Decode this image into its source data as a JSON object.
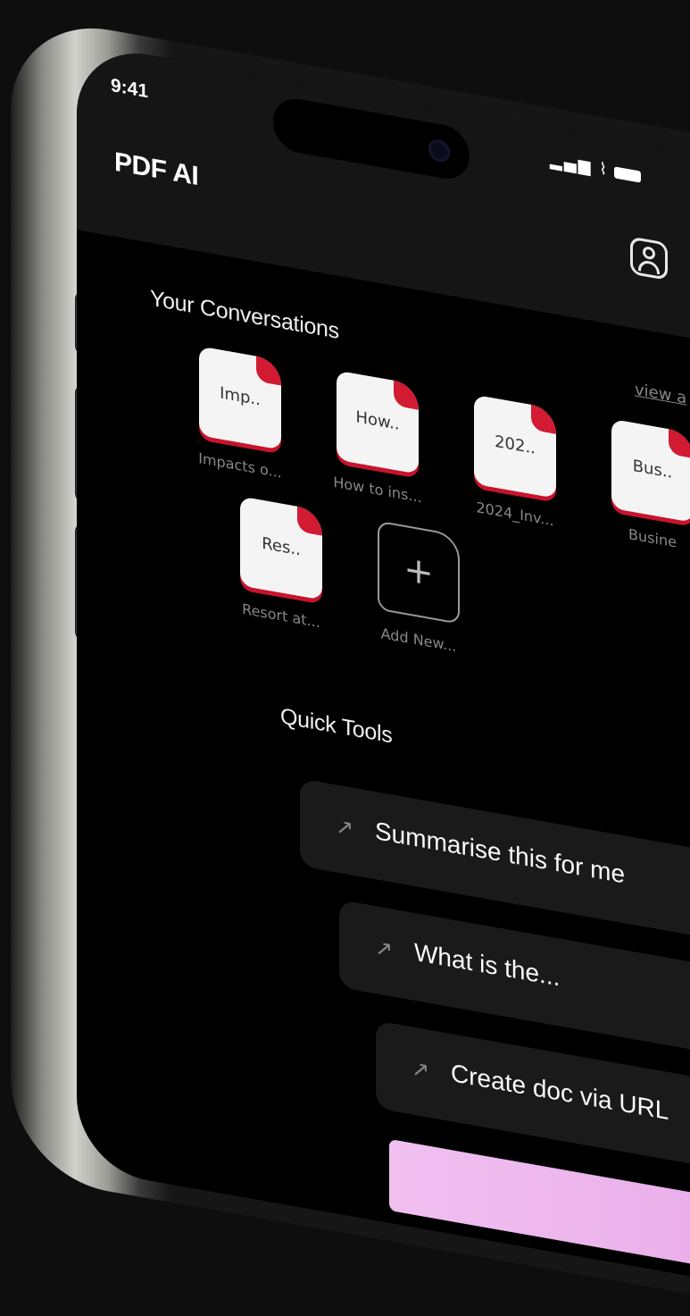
{
  "status_bar": {
    "time": "9:41",
    "signal_wifi": "▂▄▆ ⌇"
  },
  "header": {
    "title": "PDF AI",
    "profile_icon": "user-icon"
  },
  "conversations": {
    "title": "Your Conversations",
    "view_all_label": "view a",
    "items": [
      {
        "abbr": "Imp..",
        "label": "Impacts o..."
      },
      {
        "abbr": "How..",
        "label": "How to ins..."
      },
      {
        "abbr": "202..",
        "label": "2024_Inv..."
      },
      {
        "abbr": "Bus..",
        "label": "Busine"
      },
      {
        "abbr": "Res..",
        "label": "Resort at..."
      }
    ],
    "add_new": {
      "icon": "+",
      "label": "Add New..."
    }
  },
  "quick_tools": {
    "title": "Quick Tools",
    "arrow_icon": "↗",
    "items": [
      {
        "label": "Summarise this for me"
      },
      {
        "label": "What is the..."
      },
      {
        "label": "Create doc via URL"
      }
    ]
  },
  "colors": {
    "accent": "#d21a33",
    "background": "#000000",
    "card": "#1a1a1b"
  }
}
